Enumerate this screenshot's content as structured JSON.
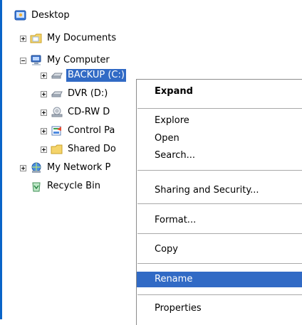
{
  "tree": {
    "desktop": "Desktop",
    "my_documents": "My Documents",
    "my_computer": "My Computer",
    "backup": "BACKUP (C:)",
    "dvr": "DVR (D:)",
    "cdrw": "CD-RW D",
    "control_panel": "Control Pa",
    "shared_docs": "Shared Do",
    "my_network": "My Network P",
    "recycle_bin": "Recycle Bin"
  },
  "context_menu": {
    "expand": "Expand",
    "explore": "Explore",
    "open": "Open",
    "search": "Search...",
    "sharing": "Sharing and Security...",
    "format": "Format...",
    "copy": "Copy",
    "rename": "Rename",
    "properties": "Properties"
  },
  "colors": {
    "selection": "#316ac5",
    "accent_bar": "#0a64c8"
  }
}
